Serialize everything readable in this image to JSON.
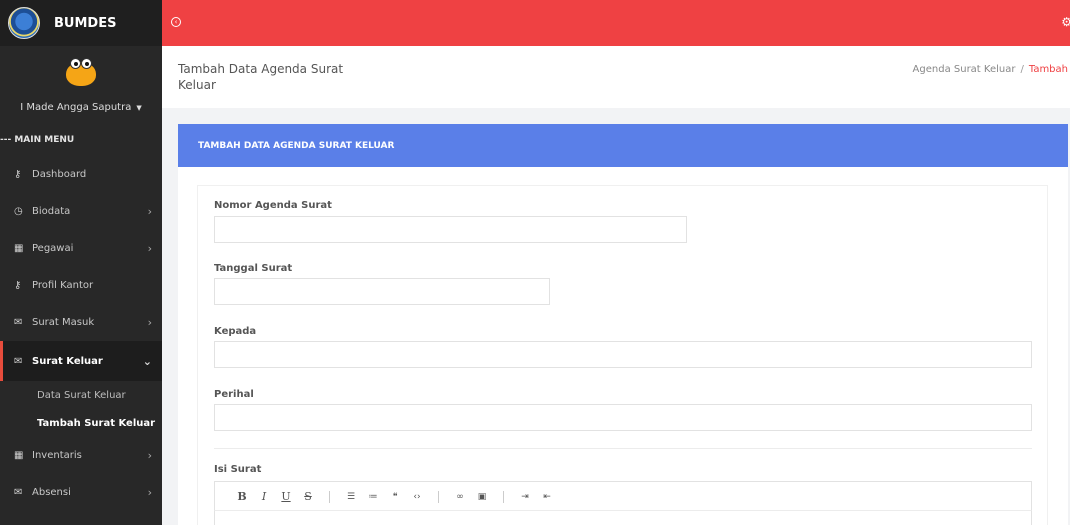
{
  "brand": {
    "name": "BUMDES"
  },
  "user": {
    "name": "I Made Angga Saputra"
  },
  "sidebar": {
    "menu_header": "--- MAIN MENU",
    "items": [
      {
        "label": "Dashboard",
        "icon": "key-icon"
      },
      {
        "label": "Biodata",
        "icon": "clock-icon"
      },
      {
        "label": "Pegawai",
        "icon": "calendar-icon"
      },
      {
        "label": "Profil Kantor",
        "icon": "key-icon"
      },
      {
        "label": "Surat Masuk",
        "icon": "mail-icon"
      },
      {
        "label": "Surat Keluar",
        "icon": "mail-icon",
        "active": true
      },
      {
        "label": "Inventaris",
        "icon": "calendar-icon"
      },
      {
        "label": "Absensi",
        "icon": "mail-icon"
      }
    ],
    "submenu": [
      {
        "label": "Data Surat Keluar"
      },
      {
        "label": "Tambah Surat Keluar",
        "current": true
      }
    ]
  },
  "page": {
    "title": "Tambah Data Agenda Surat Keluar",
    "breadcrumb": [
      "Agenda Surat Keluar",
      "Tambah"
    ]
  },
  "card": {
    "title": "TAMBAH DATA AGENDA SURAT KELUAR"
  },
  "form": {
    "nomor_label": "Nomor Agenda Surat",
    "tanggal_label": "Tanggal Surat",
    "kepada_label": "Kepada",
    "perihal_label": "Perihal",
    "isi_label": "Isi Surat",
    "nomor_value": "",
    "tanggal_value": "",
    "kepada_value": "",
    "perihal_value": ""
  },
  "colors": {
    "topbar": "#ef4143",
    "card_header": "#5a7fe8",
    "sidebar": "#282828",
    "active_border": "#e74c3c"
  }
}
